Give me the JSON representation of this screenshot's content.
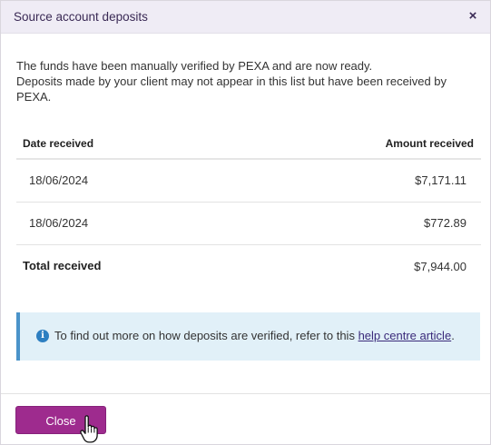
{
  "dialog": {
    "title": "Source account deposits",
    "close_symbol": "×"
  },
  "intro": {
    "line1": "The funds have been manually verified by PEXA and are now ready.",
    "line2": "Deposits made by your client may not appear in this list but have been received by PEXA."
  },
  "table": {
    "headers": {
      "date": "Date received",
      "amount": "Amount received"
    },
    "rows": [
      {
        "date": "18/06/2024",
        "amount": "$7,171.11"
      },
      {
        "date": "18/06/2024",
        "amount": "$772.89"
      }
    ],
    "total": {
      "label": "Total received",
      "amount": "$7,944.00"
    }
  },
  "info": {
    "icon": "info-icon",
    "icon_glyph": "i",
    "text_before": "To find out more on how deposits are verified, refer to this ",
    "link_text": "help centre article",
    "text_after": "."
  },
  "footer": {
    "close_label": "Close"
  },
  "colors": {
    "header_bg": "#efecf5",
    "primary_button": "#9e2b8e",
    "info_bg": "#e1f0f8",
    "info_accent": "#4a93c9",
    "link": "#3a2a7a"
  }
}
